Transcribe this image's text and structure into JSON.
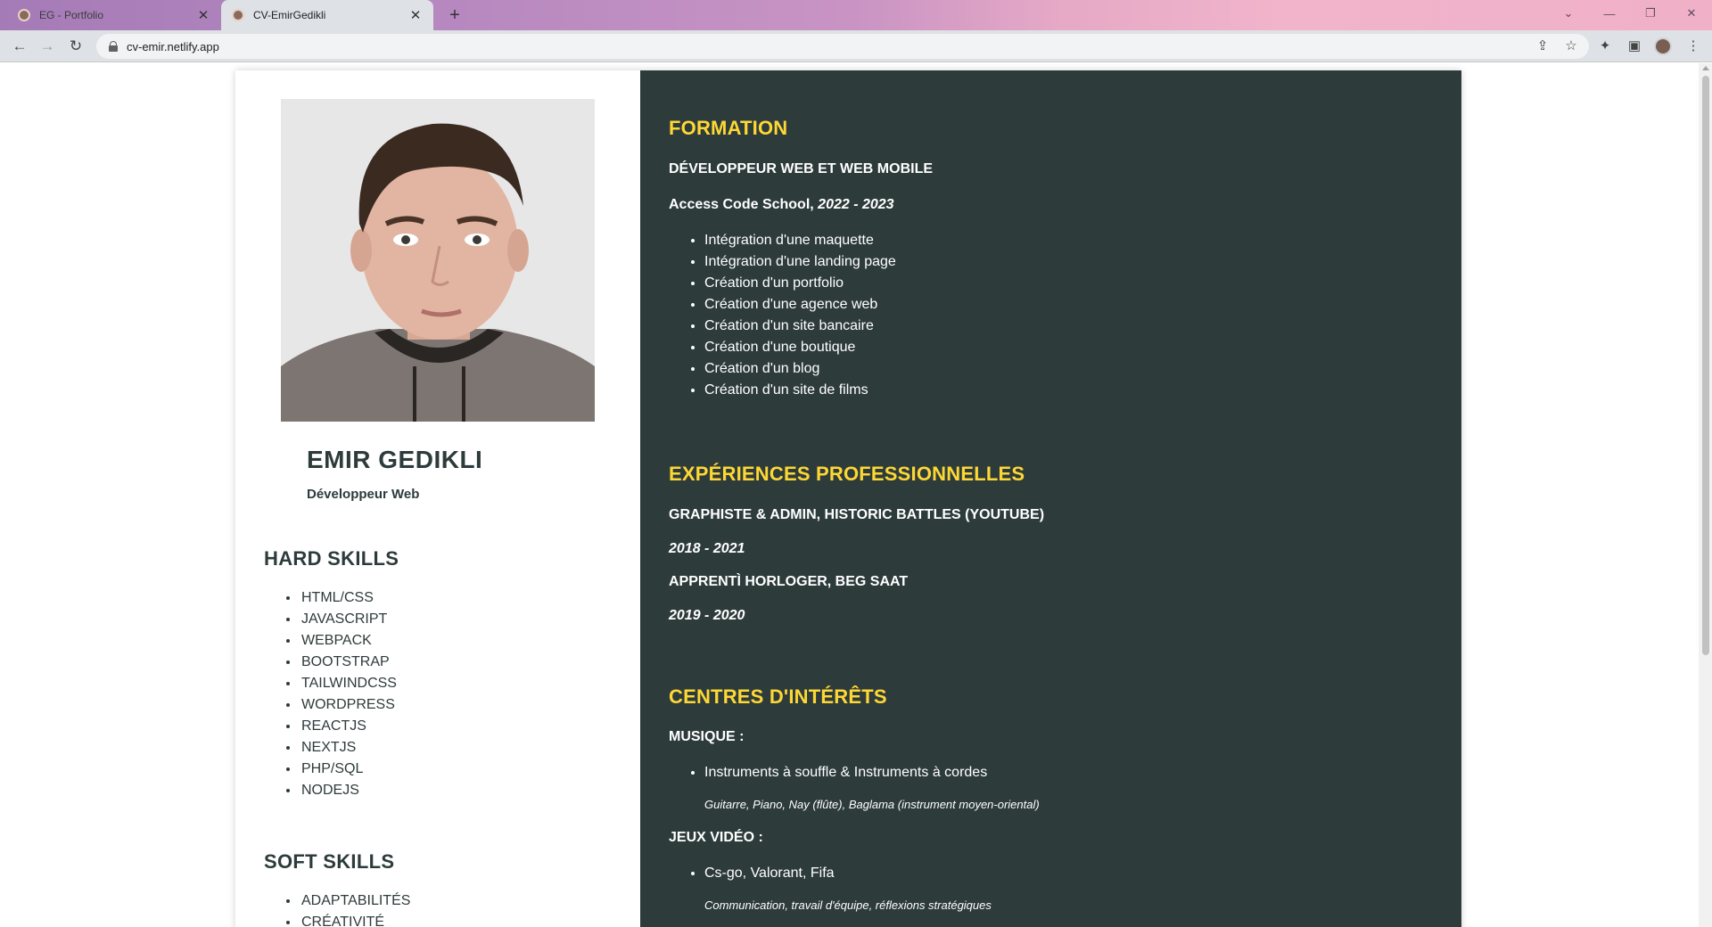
{
  "browser": {
    "tabs": [
      {
        "title": "EG - Portfolio",
        "active": false
      },
      {
        "title": "CV-EmirGedikli",
        "active": true
      }
    ],
    "new_tab": "+",
    "url": "cv-emir.netlify.app"
  },
  "profile": {
    "name": "EMIR GEDIKLI",
    "role": "Développeur Web"
  },
  "hard_skills": {
    "title": "HARD SKILLS",
    "items": [
      "HTML/CSS",
      "JAVASCRIPT",
      "WEBPACK",
      "BOOTSTRAP",
      "TAILWINDCSS",
      "WORDPRESS",
      "REACTJS",
      "NEXTJS",
      "PHP/SQL",
      "NODEJS"
    ]
  },
  "soft_skills": {
    "title": "SOFT SKILLS",
    "items": [
      "ADAPTABILITÉS",
      "CRÉATIVITÉ"
    ]
  },
  "formation": {
    "title": "FORMATION",
    "degree": "DÉVELOPPEUR WEB ET WEB MOBILE",
    "school": "Access Code School,",
    "years": "2022 - 2023",
    "items": [
      "Intégration d'une maquette",
      "Intégration d'une landing page",
      "Création d'un portfolio",
      "Création d'une agence web",
      "Création d'un site bancaire",
      "Création d'une boutique",
      "Création d'un blog",
      "Création d'un site de films"
    ]
  },
  "experience": {
    "title": "EXPÉRIENCES PROFESSIONNELLES",
    "jobs": [
      {
        "title": "GRAPHISTE & ADMIN, HISTORIC BATTLES (YOUTUBE)",
        "dates": "2018 - 2021"
      },
      {
        "title": "APPRENTÌ HORLOGER, BEG SAAT",
        "dates": "2019 - 2020"
      }
    ]
  },
  "interests": {
    "title": "CENTRES D'INTÉRÊTS",
    "music": {
      "label": "MUSIQUE :",
      "item": "Instruments à souffle & Instruments à cordes",
      "note": "Guitarre, Piano, Nay (flûte), Baglama (instrument moyen-oriental)"
    },
    "games": {
      "label": "JEUX VIDÉO :",
      "item": "Cs-go, Valorant, Fifa",
      "note": "Communication, travail d'équipe, réflexions stratégiques"
    }
  },
  "colors": {
    "accent": "#fdd835",
    "dark_panel": "#2e3b3b",
    "text_dark": "#2e3b3b"
  }
}
